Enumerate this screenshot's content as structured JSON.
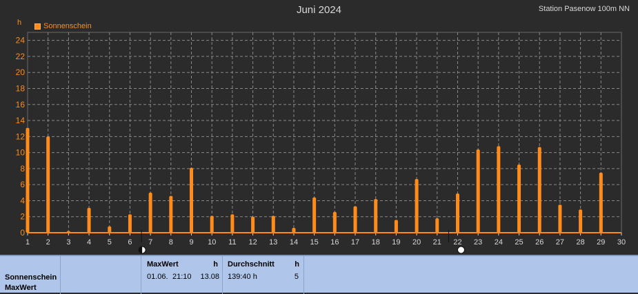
{
  "header": {
    "title": "Juni 2024",
    "station": "Station Pasenow 100m NN",
    "unit": "h"
  },
  "legend": {
    "label": "Sonnenschein"
  },
  "colors": {
    "series": "#ff8c1a",
    "grid": "#8a8a8a",
    "background": "#2b2b2b",
    "axis_text": "#ff8c1a",
    "x_text": "#d8d8d8"
  },
  "chart_data": {
    "type": "bar",
    "title": "Juni 2024",
    "ylabel": "h",
    "xlabel": "",
    "xlim": [
      1,
      30
    ],
    "ylim": [
      0,
      25
    ],
    "yticks": [
      0,
      2,
      4,
      6,
      8,
      10,
      12,
      14,
      16,
      18,
      20,
      22,
      24
    ],
    "xticks": [
      1,
      2,
      3,
      4,
      5,
      6,
      7,
      8,
      9,
      10,
      11,
      12,
      13,
      14,
      15,
      16,
      17,
      18,
      19,
      20,
      21,
      22,
      23,
      24,
      25,
      26,
      27,
      28,
      29,
      30
    ],
    "grid": true,
    "legend_position": "top-left",
    "series": [
      {
        "name": "Sonnenschein",
        "x": [
          1,
          2,
          3,
          4,
          5,
          6,
          7,
          8,
          9,
          10,
          11,
          12,
          13,
          14,
          15,
          16,
          17,
          18,
          19,
          20,
          21,
          22,
          23,
          24,
          25,
          26,
          27,
          28,
          29
        ],
        "values": [
          13.08,
          12.0,
          0.2,
          3.1,
          0.8,
          2.3,
          5.0,
          4.6,
          8.1,
          2.1,
          2.3,
          2.0,
          2.1,
          0.6,
          4.4,
          2.6,
          3.3,
          4.2,
          1.6,
          6.7,
          1.8,
          4.9,
          10.4,
          10.8,
          8.5,
          10.7,
          3.5,
          2.9,
          7.5
        ]
      }
    ],
    "markers": [
      {
        "x": 7,
        "symbol": "first-quarter-moon-icon"
      },
      {
        "x": 22,
        "symbol": "full-moon-icon"
      }
    ]
  },
  "footer": {
    "row_label_1": "Sonnenschein",
    "row_label_2": "MaxWert",
    "max": {
      "header": "MaxWert",
      "unit": "h",
      "date": "01.06.",
      "time": "21:10",
      "value": "13.08"
    },
    "avg": {
      "header": "Durchschnitt",
      "unit": "h",
      "sum": "139:40 h",
      "value": "5"
    }
  }
}
